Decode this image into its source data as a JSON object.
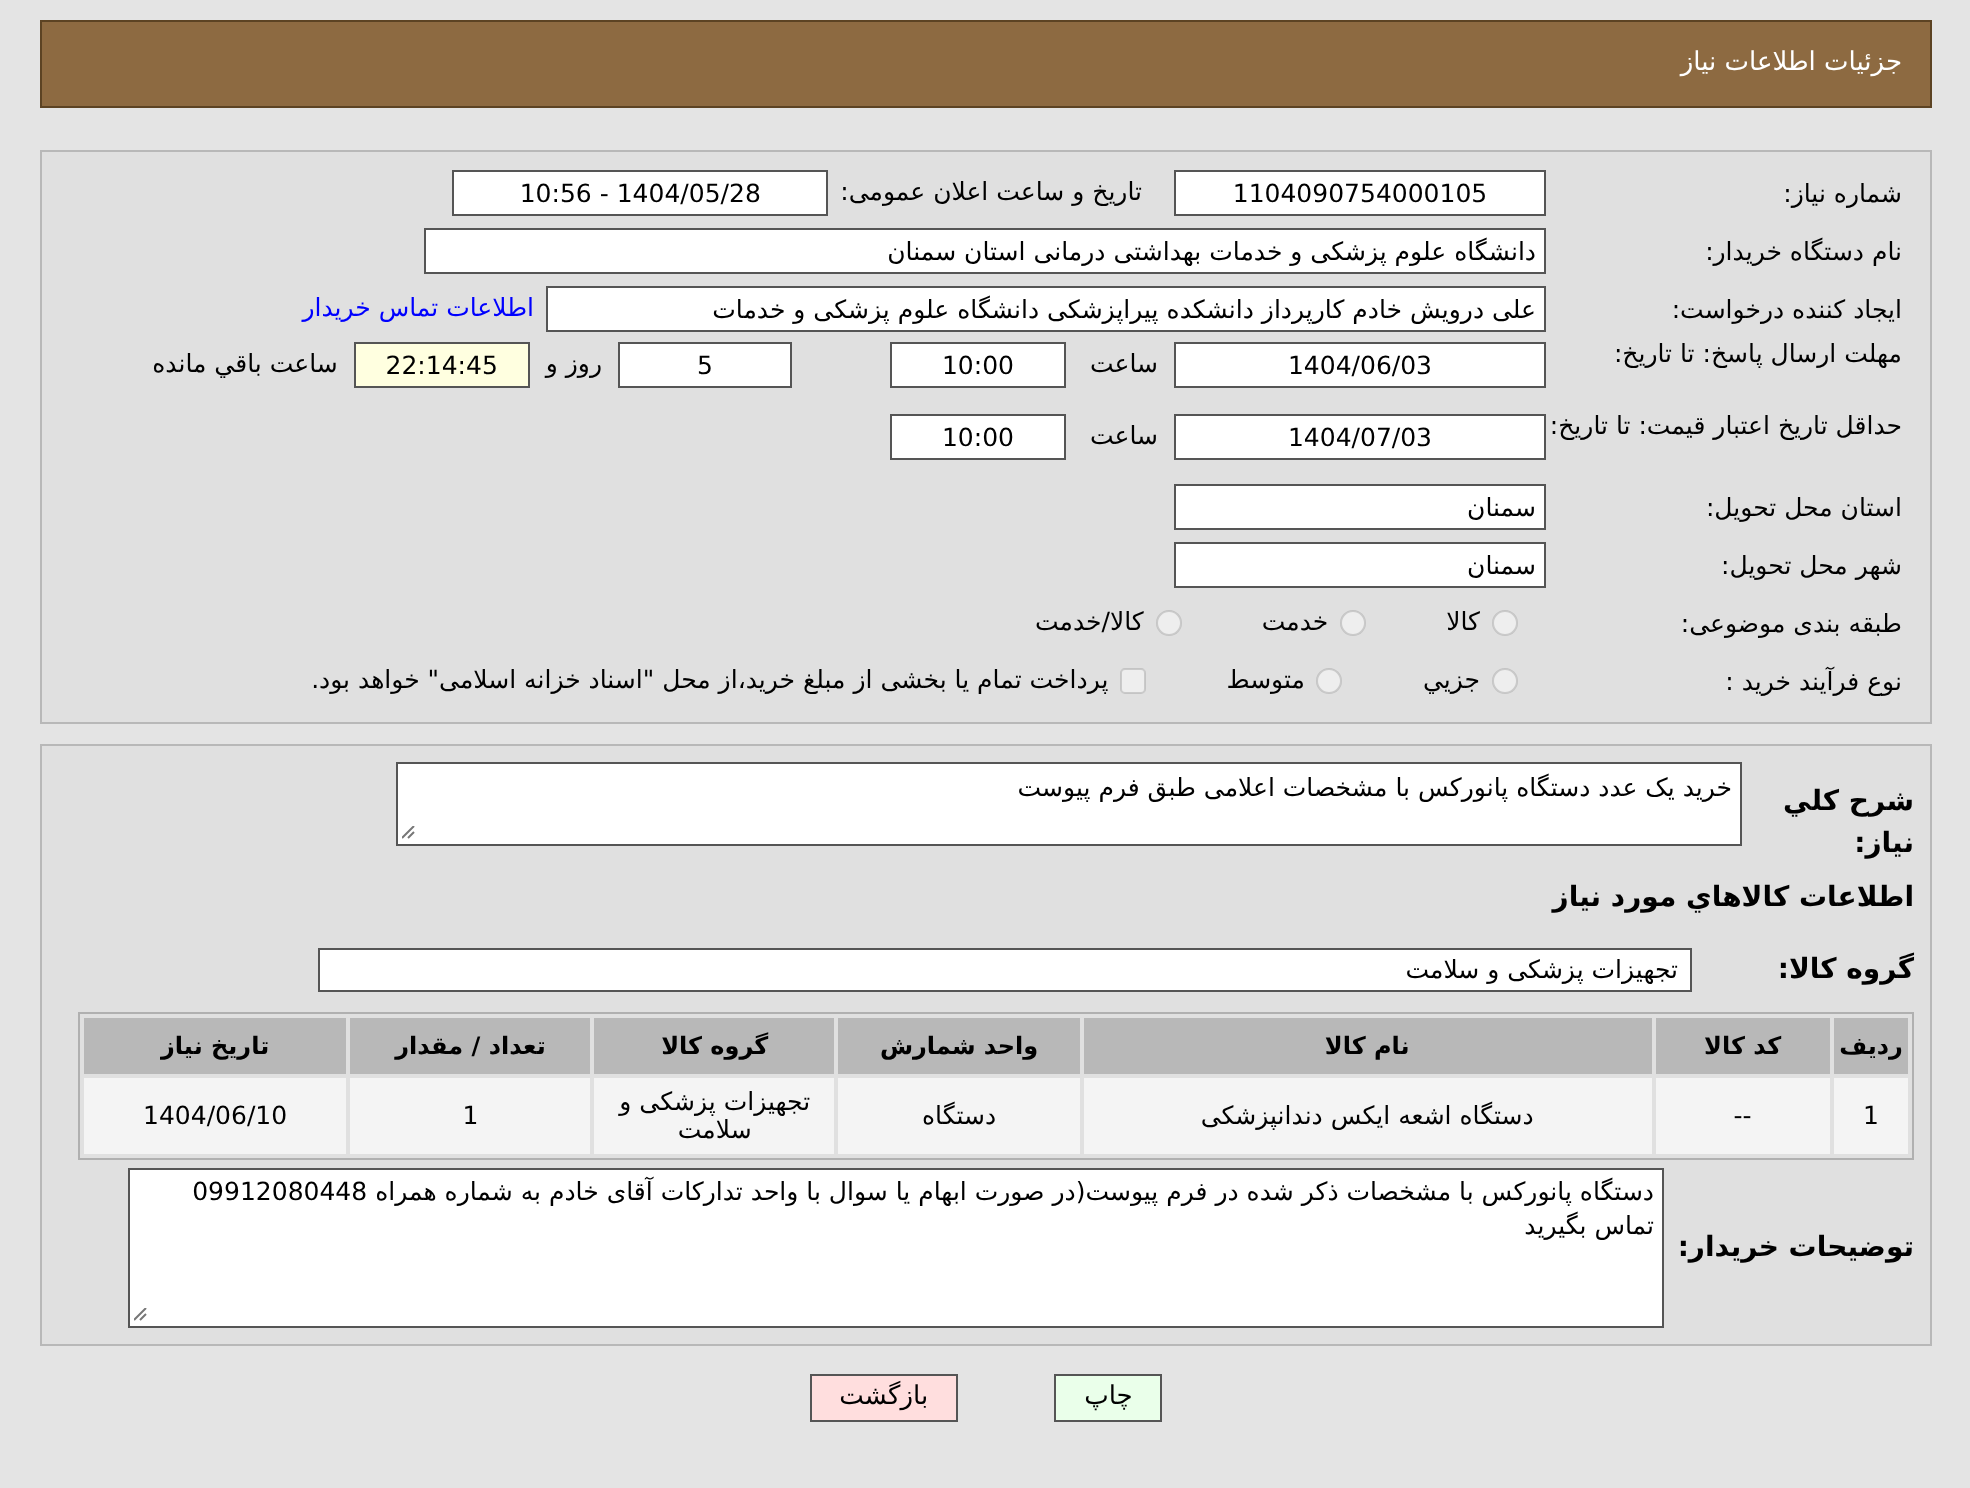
{
  "header": {
    "title": "جزئیات اطلاعات نیاز"
  },
  "need_number": {
    "label": "شماره نیاز:",
    "value": "1104090754000105"
  },
  "announce": {
    "label": "تاریخ و ساعت اعلان عمومی:",
    "value": "1404/05/28 - 10:56"
  },
  "buyer": {
    "label": "نام دستگاه خریدار:",
    "value": "دانشگاه علوم پزشکی و خدمات بهداشتی  درمانی استان سمنان"
  },
  "creator": {
    "label": "ایجاد کننده درخواست:",
    "value": "علی درویش خادم کارپرداز دانشکده پیراپزشکی دانشگاه علوم پزشکی و خدمات",
    "link": "اطلاعات تماس خریدار"
  },
  "reply_deadline": {
    "label": "مهلت ارسال پاسخ: تا تاریخ:",
    "date": "1404/06/03",
    "time_label": "ساعت",
    "time": "10:00",
    "days": "5",
    "days_label": "روز و",
    "remaining": "22:14:45",
    "remaining_label": "ساعت باقي مانده"
  },
  "price_validity": {
    "label": "حداقل تاریخ اعتبار قیمت: تا تاریخ:",
    "date": "1404/07/03",
    "time_label": "ساعت",
    "time": "10:00"
  },
  "province": {
    "label": "استان محل تحویل:",
    "value": "سمنان"
  },
  "city": {
    "label": "شهر محل تحویل:",
    "value": "سمنان"
  },
  "category": {
    "label": "طبقه بندی موضوعی:",
    "options": [
      {
        "label": "کالا",
        "selected": false
      },
      {
        "label": "خدمت",
        "selected": false
      },
      {
        "label": "کالا/خدمت",
        "selected": false
      }
    ]
  },
  "purchase_type": {
    "label": "نوع فرآیند خرید :",
    "options": [
      {
        "label": "جزيي",
        "selected": false
      },
      {
        "label": "متوسط",
        "selected": false
      }
    ],
    "note": {
      "text": "پرداخت تمام یا بخشی از مبلغ خرید،از محل \"اسناد خزانه اسلامی\" خواهد بود.",
      "checked": false
    }
  },
  "summary": {
    "label": "شرح کلي نیاز:",
    "value": "خرید یک عدد دستگاه پانورکس با مشخصات اعلامی طبق فرم پیوست"
  },
  "goods_heading": "اطلاعات کالاهاي مورد نیاز",
  "goods_group": {
    "label": "گروه کالا:",
    "value": "تجهیزات پزشکی و سلامت"
  },
  "table": {
    "columns": [
      "ردیف",
      "کد کالا",
      "نام کالا",
      "واحد شمارش",
      "گروه کالا",
      "تعداد / مقدار",
      "تاریخ نیاز"
    ],
    "rows": [
      [
        "1",
        "--",
        "دستگاه اشعه ایکس دندانپزشکی",
        "دستگاه",
        "تجهیزات پزشکی و سلامت",
        "1",
        "1404/06/10"
      ]
    ]
  },
  "buyer_notes": {
    "label": "توضیحات خریدار:",
    "value": "دستگاه پانورکس با مشخصات ذکر شده در فرم پیوست(در صورت ابهام یا سوال با واحد تدارکات آقای خادم به شماره همراه 09912080448 تماس بگیرید"
  },
  "buttons": [
    {
      "label": "چاپ",
      "kind": "print"
    },
    {
      "label": "بازگشت",
      "kind": "back"
    }
  ]
}
